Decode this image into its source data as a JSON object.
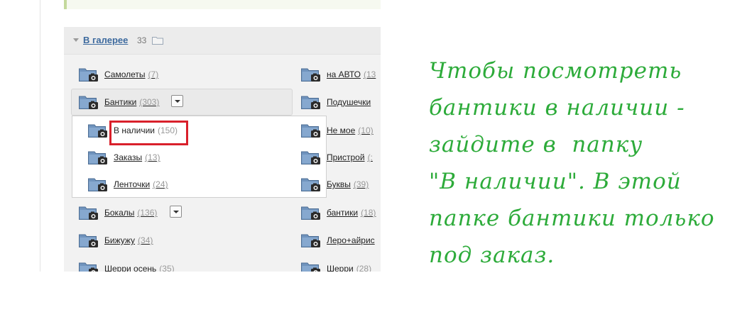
{
  "gallery": {
    "title": "В галерее",
    "count": "33",
    "left_column": [
      {
        "name": "Самолеты",
        "count": "(7)"
      },
      {
        "name": "Бантики",
        "count": "(303)",
        "has_menu": true,
        "expanded": true
      },
      {
        "name": "Бокалы",
        "count": "(136)",
        "has_menu": true
      },
      {
        "name": "Бижужу",
        "count": "(34)"
      },
      {
        "name": "Шерри осень",
        "count": "(35)"
      }
    ],
    "submenu": [
      {
        "name": "В наличии",
        "count": "(150)",
        "highlighted": true
      },
      {
        "name": "Заказы",
        "count": "(13)"
      },
      {
        "name": "Ленточки",
        "count": "(24)"
      }
    ],
    "right_column": [
      {
        "name": "на АВТО",
        "count": "(13"
      },
      {
        "name": "Подушечки",
        "count": ""
      },
      {
        "name": "Не мое",
        "count": "(10)"
      },
      {
        "name": "Пристрой",
        "count": "(:"
      },
      {
        "name": "Буквы",
        "count": "(39)"
      },
      {
        "name": "бантики",
        "count": "(18)"
      },
      {
        "name": "Леро+айрис",
        "count": ""
      },
      {
        "name": "Шерри",
        "count": "(28)"
      }
    ]
  },
  "annotation": {
    "lines": [
      "Чтобы посмотреть",
      "бантики в наличии -",
      "зайдите в  папку",
      "\"В наличии\". В этой",
      "папке бантики только",
      "под заказ."
    ]
  },
  "colors": {
    "annotation_green": "#2dab3a",
    "highlight_red": "#d9202b",
    "link_blue": "#3d6a9e",
    "folder_blue": "#6f93bd"
  },
  "icons": [
    "caret-down-icon",
    "folder-outline-icon",
    "camera-folder-icon",
    "dropdown-arrow-icon"
  ]
}
